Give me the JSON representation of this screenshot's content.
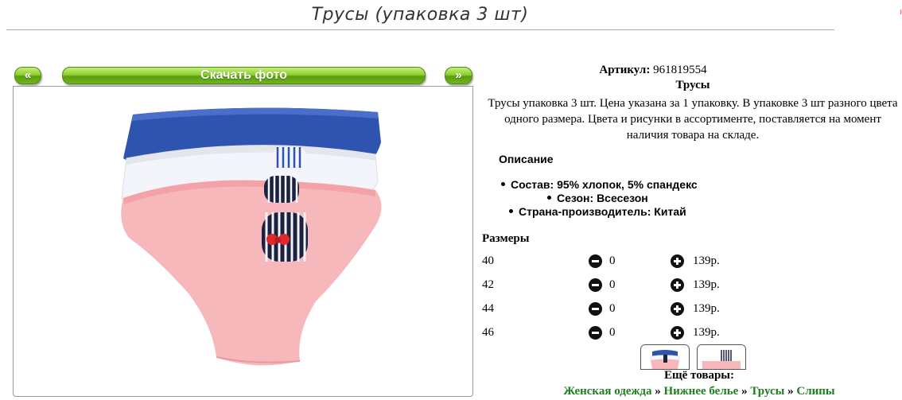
{
  "page": {
    "title": "Трусы (упаковка 3 шт)",
    "corner_mark": "⁾"
  },
  "gallery": {
    "prev_label": "«",
    "download_label": "Скачать фото",
    "next_label": "»"
  },
  "product": {
    "article_label": "Артикул:",
    "article_value": "961819554",
    "name": "Трусы",
    "description": "Трусы упаковка 3 шт. Цена указана за 1 упаковку. В упаковке 3 шт разного цвета одного размера. Цвета и рисунки в ассортименте, поставляется на момент наличия товара на складе.",
    "desc_heading": "Описание",
    "specs": [
      "Состав: 95% хлопок, 5% спандекс",
      "Сезон: Всесезон",
      "Страна-производитель: Китай"
    ]
  },
  "sizes": {
    "heading": "Размеры",
    "rows": [
      {
        "size": "40",
        "qty": "0",
        "price": "139р."
      },
      {
        "size": "42",
        "qty": "0",
        "price": "139р."
      },
      {
        "size": "44",
        "qty": "0",
        "price": "139р."
      },
      {
        "size": "46",
        "qty": "0",
        "price": "139р."
      }
    ]
  },
  "more": {
    "heading": "Ещё товары:",
    "breadcrumbs": [
      "Женская одежда",
      "Нижнее белье",
      "Трусы",
      "Слипы"
    ],
    "separator": "»"
  },
  "colors": {
    "button_green": "#6fb51d",
    "link_green": "#1d7f1d",
    "panty_blue": "#2f54b0",
    "panty_white": "#f4f5fa",
    "panty_pink": "#f6b8bb",
    "bow_red": "#e0282c"
  }
}
